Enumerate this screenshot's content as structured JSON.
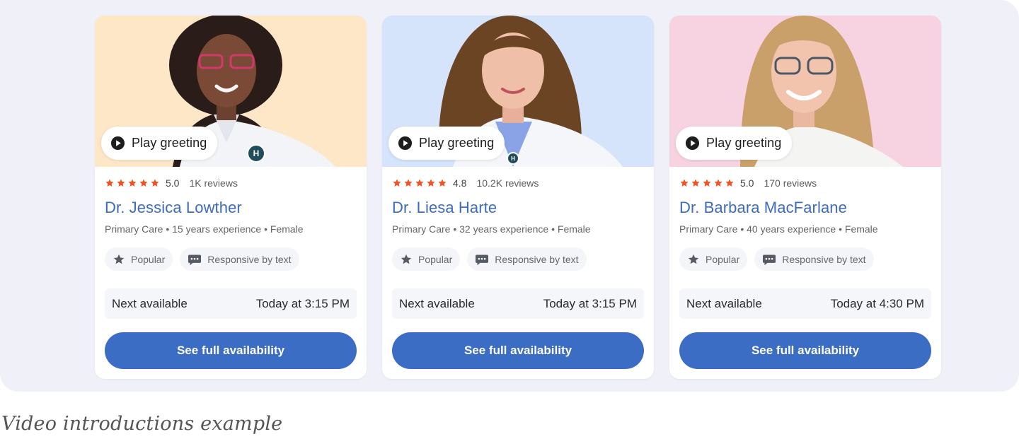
{
  "caption": "Video introductions example",
  "colors": {
    "star": "#f4511e",
    "name": "#3d6bbd",
    "button": "#3b6dc4",
    "stage_bg": "#f0f1f8"
  },
  "cards": [
    {
      "photo_bg": "#fde7c7",
      "play_label": "Play greeting",
      "rating": "5.0",
      "reviews": "1K reviews",
      "name": "Dr. Jessica Lowther",
      "meta": "Primary Care • 15 years experience • Female",
      "chip_popular": "Popular",
      "chip_text": "Responsive by text",
      "avail_label": "Next available",
      "avail_time": "Today at 3:15 PM",
      "cta": "See full availability"
    },
    {
      "photo_bg": "#d6e4fb",
      "play_label": "Play greeting",
      "rating": "4.8",
      "reviews": "10.2K reviews",
      "name": "Dr. Liesa Harte",
      "meta": "Primary Care • 32 years experience • Female",
      "chip_popular": "Popular",
      "chip_text": "Responsive by text",
      "avail_label": "Next available",
      "avail_time": "Today at 3:15 PM",
      "cta": "See full availability"
    },
    {
      "photo_bg": "#f7d3e2",
      "play_label": "Play greeting",
      "rating": "5.0",
      "reviews": "170 reviews",
      "name": "Dr. Barbara MacFarlane",
      "meta": "Primary Care • 40 years experience • Female",
      "chip_popular": "Popular",
      "chip_text": "Responsive by text",
      "avail_label": "Next available",
      "avail_time": "Today at 4:30 PM",
      "cta": "See full availability"
    }
  ]
}
